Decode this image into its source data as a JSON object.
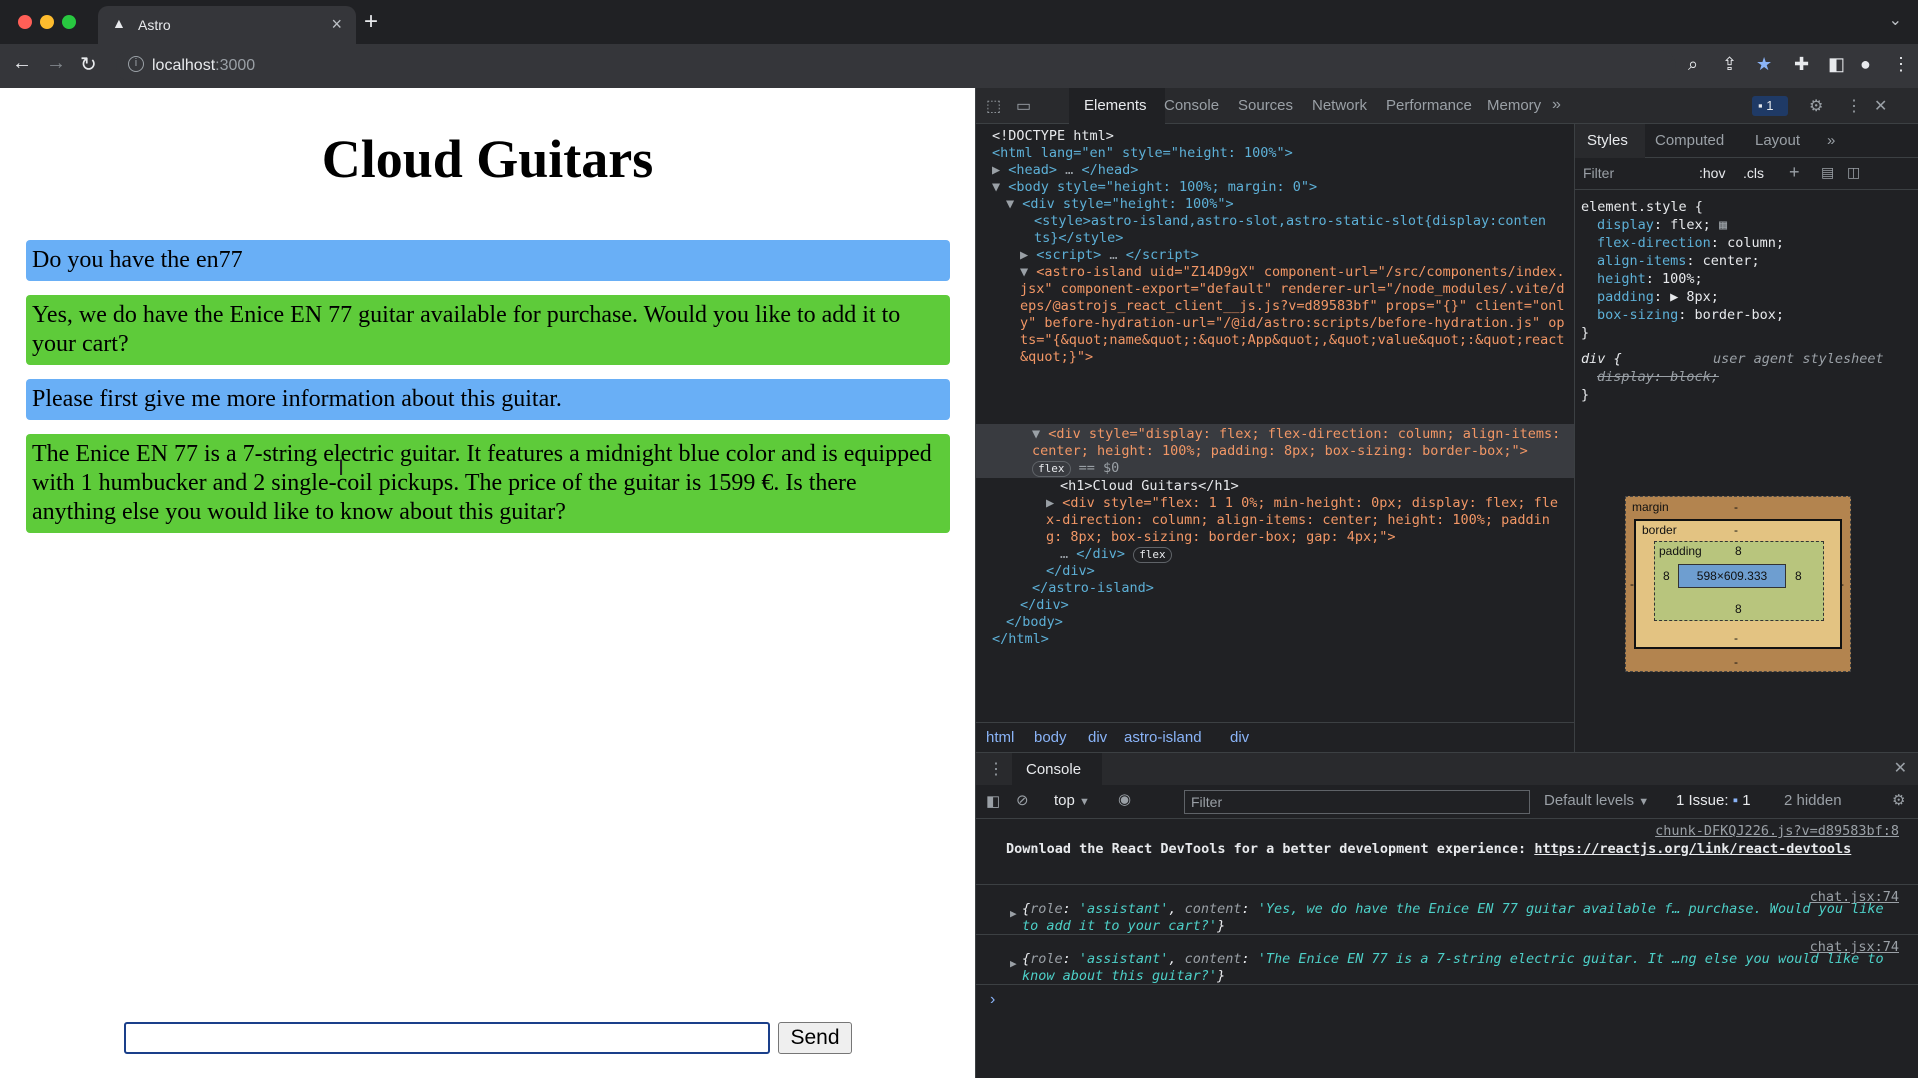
{
  "browser": {
    "tab_title": "Astro",
    "url_host": "localhost",
    "url_port": ":3000"
  },
  "page": {
    "heading": "Cloud Guitars",
    "messages": [
      {
        "role": "user",
        "text": "Do you have the en77"
      },
      {
        "role": "assistant",
        "text": "Yes, we do have the Enice EN 77 guitar available for purchase. Would you like to add it to your cart?"
      },
      {
        "role": "user",
        "text": "Please first give me more information about this guitar."
      },
      {
        "role": "assistant",
        "text": "The Enice EN 77 is a 7-string electric guitar. It features a midnight blue color and is equipped with 1 humbucker and 2 single-coil pickups. The price of the guitar is 1599 €. Is there anything else you would like to know about this guitar?"
      }
    ],
    "input_value": "",
    "send_label": "Send"
  },
  "devtools": {
    "tabs": [
      "Elements",
      "Console",
      "Sources",
      "Network",
      "Performance",
      "Memory"
    ],
    "issues_badge": "1",
    "dom_lines": [
      "<!DOCTYPE html>",
      "<html lang=\"en\" style=\"height: 100%\">",
      "<head>",
      "<body style=\"height: 100%; margin: 0\">",
      "<div style=\"height: 100%\">",
      "<style>astro-island,astro-slot,astro-static-slot{display:contents}</style>",
      "<script>",
      "<astro-island uid=\"Z14D9gX\" component-url=\"/src/components/index.jsx\" component-export=\"default\" renderer-url=\"/node_modules/.vite/deps/@astrojs_react_client__js.js?v=d89583bf\" props=\"{}\" client=\"only\" before-hydration-url=\"/@id/astro:scripts/before-hydration.js\" opts=\"{&quot;name&quot;:&quot;App&quot;,&quot;value&quot;:&quot;react&quot;}\">",
      "<div style=\"display: flex; flex-direction: column; align-items: center; height: 100%; padding: 8px; box-sizing: border-box;\">",
      "<h1>Cloud Guitars</h1>",
      "<div style=\"flex: 1 1 0%; min-height: 0px; display: flex; flex-direction: column; align-items: center; height: 100%; padding: 8px; box-sizing: border-box; gap: 4px;\">",
      "</div>",
      "</astro-island>",
      "</div>",
      "</body>",
      "</html>"
    ],
    "flex_pill": "flex",
    "dollar_zero": "== $0",
    "breadcrumbs": [
      "html",
      "body",
      "div",
      "astro-island",
      "div"
    ],
    "styles_tabs": [
      "Styles",
      "Computed",
      "Layout"
    ],
    "filter_placeholder": "Filter",
    "hov": ":hov",
    "cls": ".cls",
    "element_style_selector": "element.style {",
    "element_style_rules": [
      {
        "prop": "display",
        "value": "flex;"
      },
      {
        "prop": "flex-direction",
        "value": "column;"
      },
      {
        "prop": "align-items",
        "value": "center;"
      },
      {
        "prop": "height",
        "value": "100%;"
      },
      {
        "prop": "padding",
        "value": "▶ 8px;"
      },
      {
        "prop": "box-sizing",
        "value": "border-box;"
      }
    ],
    "ua_selector": "div {",
    "ua_label": "user agent stylesheet",
    "ua_rule": "display: block;",
    "box_model": {
      "margin_label": "margin",
      "margin_value": "-",
      "border_label": "border",
      "border_value": "-",
      "padding_label": "padding",
      "padding_value": "8",
      "content_size": "598×609.333",
      "side_value": "8",
      "dash": "-"
    },
    "console": {
      "tab": "Console",
      "context": "top",
      "filter_placeholder": "Filter",
      "levels": "Default levels",
      "issues": "1 Issue:",
      "issues_count": "1",
      "hidden": "2 hidden",
      "messages": [
        {
          "source": "chunk-DFKQJ226.js?v=d89583bf:8",
          "text": "Download the React DevTools for a better development experience: ",
          "link": "https://reactjs.org/link/react-devtools"
        },
        {
          "source": "chat.jsx:74",
          "role_key": "role",
          "role_val": "'assistant'",
          "content_key": "content",
          "content_val": "'Yes, we do have the Enice EN 77 guitar available f… purchase. Would you like to add it to your cart?'"
        },
        {
          "source": "chat.jsx:74",
          "role_key": "role",
          "role_val": "'assistant'",
          "content_key": "content",
          "content_val": "'The Enice EN 77 is a 7-string electric guitar. It …ng else you would like to know about this guitar?'"
        }
      ]
    }
  },
  "colors": {
    "user_bubble": "#69aff6",
    "assistant_bubble": "#5ecb3a",
    "devtools_bg": "#202124"
  }
}
